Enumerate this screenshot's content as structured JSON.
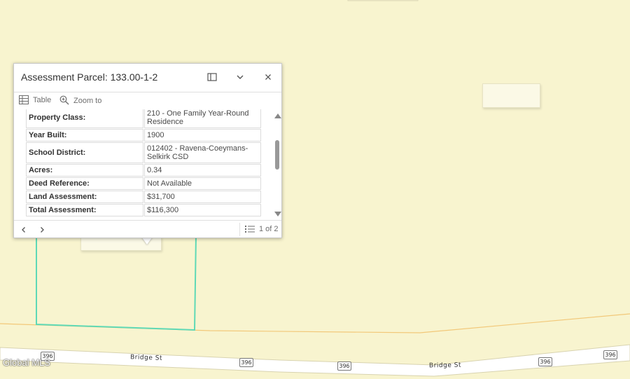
{
  "popup": {
    "title": "Assessment Parcel: 133.00-1-2",
    "actions": {
      "table_label": "Table",
      "zoom_label": "Zoom to"
    },
    "rows": [
      {
        "label": "Property Class:",
        "value": "210 - One Family Year-Round Residence"
      },
      {
        "label": "Year Built:",
        "value": "1900"
      },
      {
        "label": "School District:",
        "value": "012402 - Ravena-Coeymans-Selkirk CSD"
      },
      {
        "label": "Acres:",
        "value": "0.34"
      },
      {
        "label": "Deed Reference:",
        "value": "Not Available"
      },
      {
        "label": "Land Assessment:",
        "value": "$31,700"
      },
      {
        "label": "Total Assessment:",
        "value": "$116,300"
      }
    ],
    "pager_label": "1 of 2"
  },
  "map": {
    "road_labels": [
      "Bridge St",
      "Bridge St"
    ],
    "route_shields": [
      "396",
      "396",
      "396",
      "396",
      "396"
    ],
    "watermark": "Global MLS",
    "colors": {
      "land": "#f8f4cf",
      "parcel_outline": "#5fd9b6",
      "road_line": "#f2c879"
    }
  }
}
